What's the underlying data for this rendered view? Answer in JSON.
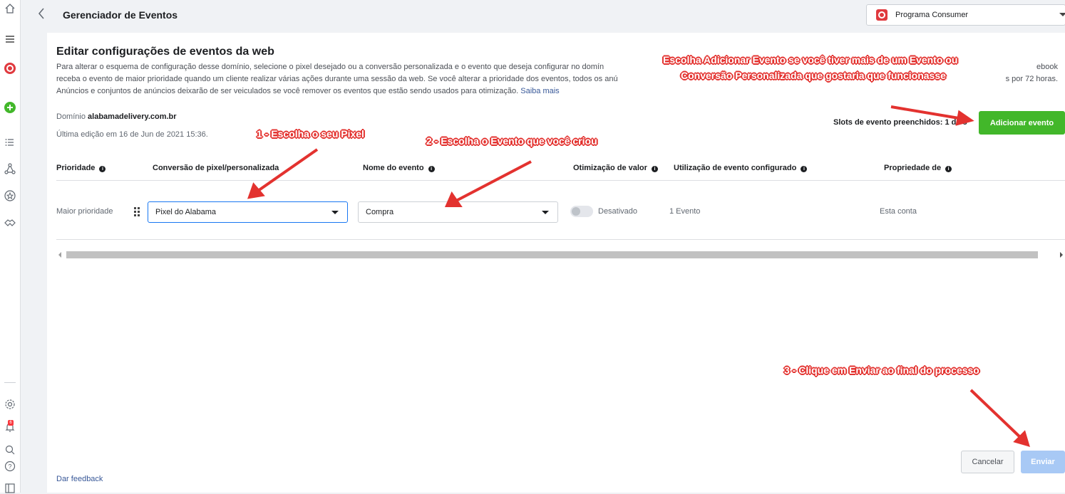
{
  "header": {
    "back_icon": "chevron-left-icon",
    "title": "Gerenciador de Eventos",
    "account_name": "Programa Consumer"
  },
  "sidebar": {
    "icons": [
      "home-icon",
      "menu-icon",
      "brand-icon",
      "add-icon",
      "list-icon",
      "network-icon",
      "star-icon",
      "handshake-icon",
      "settings-icon",
      "bell-icon",
      "search-icon",
      "help-icon",
      "panel-icon"
    ],
    "notification_count": "6"
  },
  "page": {
    "heading": "Editar configurações de eventos da web",
    "desc_line1": "Para alterar o esquema de configuração desse domínio, selecione o pixel desejado ou a conversão personalizada e o evento que deseja configurar no domín",
    "desc_line1_end": "ebook",
    "desc_line2": "receba o evento de maior prioridade quando um cliente realizar várias ações durante uma sessão da web. Se você alterar a prioridade dos eventos, todos os anú",
    "desc_line2_end": "s por 72 horas.",
    "desc_line3": "Anúncios e conjuntos de anúncios deixarão de ser veiculados se você remover os eventos que estão sendo usados para otimização.",
    "learn_more": "Saiba mais",
    "domain_label": "Domínio",
    "domain_value": "alabamadelivery.com.br",
    "last_edit": "Última edição em 16 de Jun de 2021 15:36.",
    "slots_label": "Slots de evento preenchidos: 1 de 8",
    "add_event_button": "Adicionar evento",
    "feedback": "Dar feedback",
    "cancel_button": "Cancelar",
    "submit_button": "Enviar"
  },
  "table": {
    "headers": [
      "Prioridade",
      "Conversão de pixel/personalizada",
      "Nome do evento",
      "Otimização de valor",
      "Utilização de evento configurado",
      "Propriedade de"
    ],
    "row": {
      "priority": "Maior prioridade",
      "pixel": "Pixel do Alabama",
      "event": "Compra",
      "value_opt": "Desativado",
      "usage": "1 Evento",
      "owner": "Esta conta"
    }
  },
  "annotations": {
    "step1": "1 - Escolha o seu Pixel",
    "step2": "2 - Escolha o Evento que você criou",
    "step3": "3 - Clique em Enviar ao final do processo",
    "note_line1": "Escolha Adicionar Evento se você tiver mais de um Evento ou",
    "note_line2": "Conversão Personalizada que gostaria que funcionasse"
  },
  "colors": {
    "accent_green": "#42b72a",
    "annotation_red": "#e3322f",
    "link_blue": "#385898",
    "disabled_blue": "#a8c9f5"
  }
}
